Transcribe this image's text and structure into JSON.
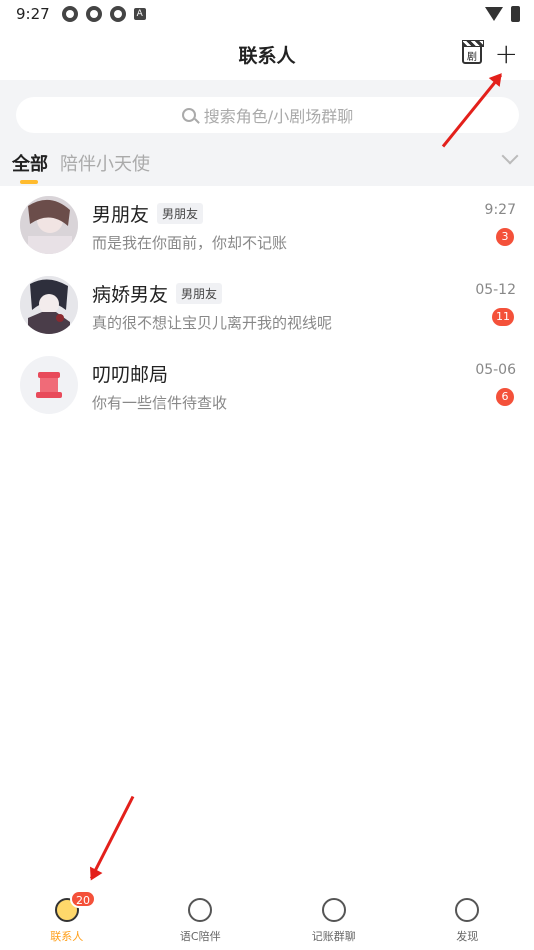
{
  "status": {
    "time": "9:27"
  },
  "header": {
    "title": "联系人",
    "clapper_glyph": "剧"
  },
  "search": {
    "placeholder": "搜索角色/小剧场群聊"
  },
  "tabs": [
    {
      "label": "全部"
    },
    {
      "label": "陪伴小天使"
    }
  ],
  "contacts": [
    {
      "name": "男朋友",
      "tag": "男朋友",
      "message": "而是我在你面前，你却不记账",
      "time": "9:27",
      "unread": "3"
    },
    {
      "name": "病娇男友",
      "tag": "男朋友",
      "message": "真的很不想让宝贝儿离开我的视线呢",
      "time": "05-12",
      "unread": "11"
    },
    {
      "name": "叨叨邮局",
      "tag": "",
      "message": "你有一些信件待查收",
      "time": "05-06",
      "unread": "6"
    }
  ],
  "bottom_nav": [
    {
      "label": "联系人",
      "badge": "20"
    },
    {
      "label": "语C陪伴"
    },
    {
      "label": "记账群聊"
    },
    {
      "label": "发现"
    }
  ],
  "colors": {
    "accent": "#ff9f1a",
    "badge": "#f4513a",
    "arrow": "#e3201b"
  }
}
